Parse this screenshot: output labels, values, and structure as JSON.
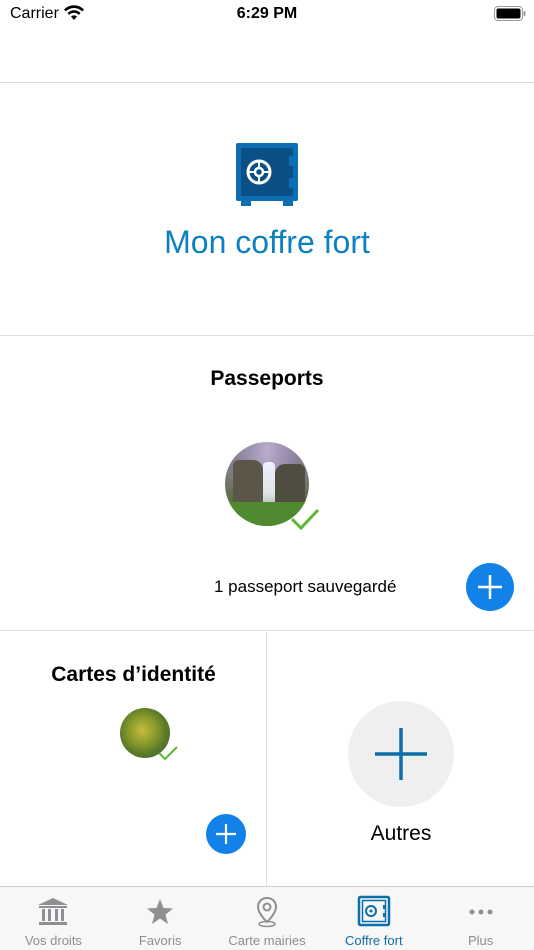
{
  "status_bar": {
    "carrier": "Carrier",
    "time": "6:29 PM"
  },
  "hero": {
    "title": "Mon coffre fort",
    "icon": "safe-icon"
  },
  "passports": {
    "title": "Passeports",
    "count_text": "1 passeport sauvegardé",
    "avatar_icon": "waterfall-photo",
    "check_icon": "checkmark-icon",
    "add_icon": "plus-icon"
  },
  "id_cards": {
    "title": "Cartes d’identité",
    "avatar_icon": "leaf-photo",
    "add_icon": "plus-icon"
  },
  "others": {
    "label": "Autres",
    "icon": "plus-icon"
  },
  "tab_bar": {
    "tabs": [
      {
        "label": "Vos droits",
        "icon": "bank-icon",
        "active": false
      },
      {
        "label": "Favoris",
        "icon": "star-icon",
        "active": false
      },
      {
        "label": "Carte mairies",
        "icon": "map-pin-icon",
        "active": false
      },
      {
        "label": "Coffre fort",
        "icon": "safe-icon",
        "active": true
      },
      {
        "label": "Plus",
        "icon": "more-icon",
        "active": false
      }
    ]
  },
  "colors": {
    "accent": "#0d80c2",
    "button_blue": "#1282e8",
    "check_green": "#5fb635",
    "tab_inactive": "#8e8e93",
    "tab_active": "#0d6fa8"
  }
}
